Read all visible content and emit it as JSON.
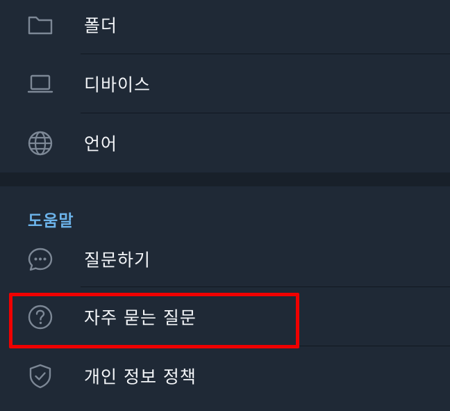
{
  "settings": {
    "items_top": [
      {
        "label": "폴더",
        "icon": "folder-icon"
      },
      {
        "label": "디바이스",
        "icon": "laptop-icon"
      },
      {
        "label": "언어",
        "icon": "globe-icon"
      }
    ],
    "help_section": {
      "title": "도움말",
      "items": [
        {
          "label": "질문하기",
          "icon": "chat-bubble-icon"
        },
        {
          "label": "자주 묻는 질문",
          "icon": "question-circle-icon"
        },
        {
          "label": "개인 정보 정책",
          "icon": "shield-check-icon"
        }
      ]
    }
  },
  "colors": {
    "background": "#1f2936",
    "section_gap": "#18202a",
    "accent": "#6cb3ea",
    "highlight": "#f00000",
    "text": "#f3f5f8",
    "icon": "#7d8896"
  }
}
